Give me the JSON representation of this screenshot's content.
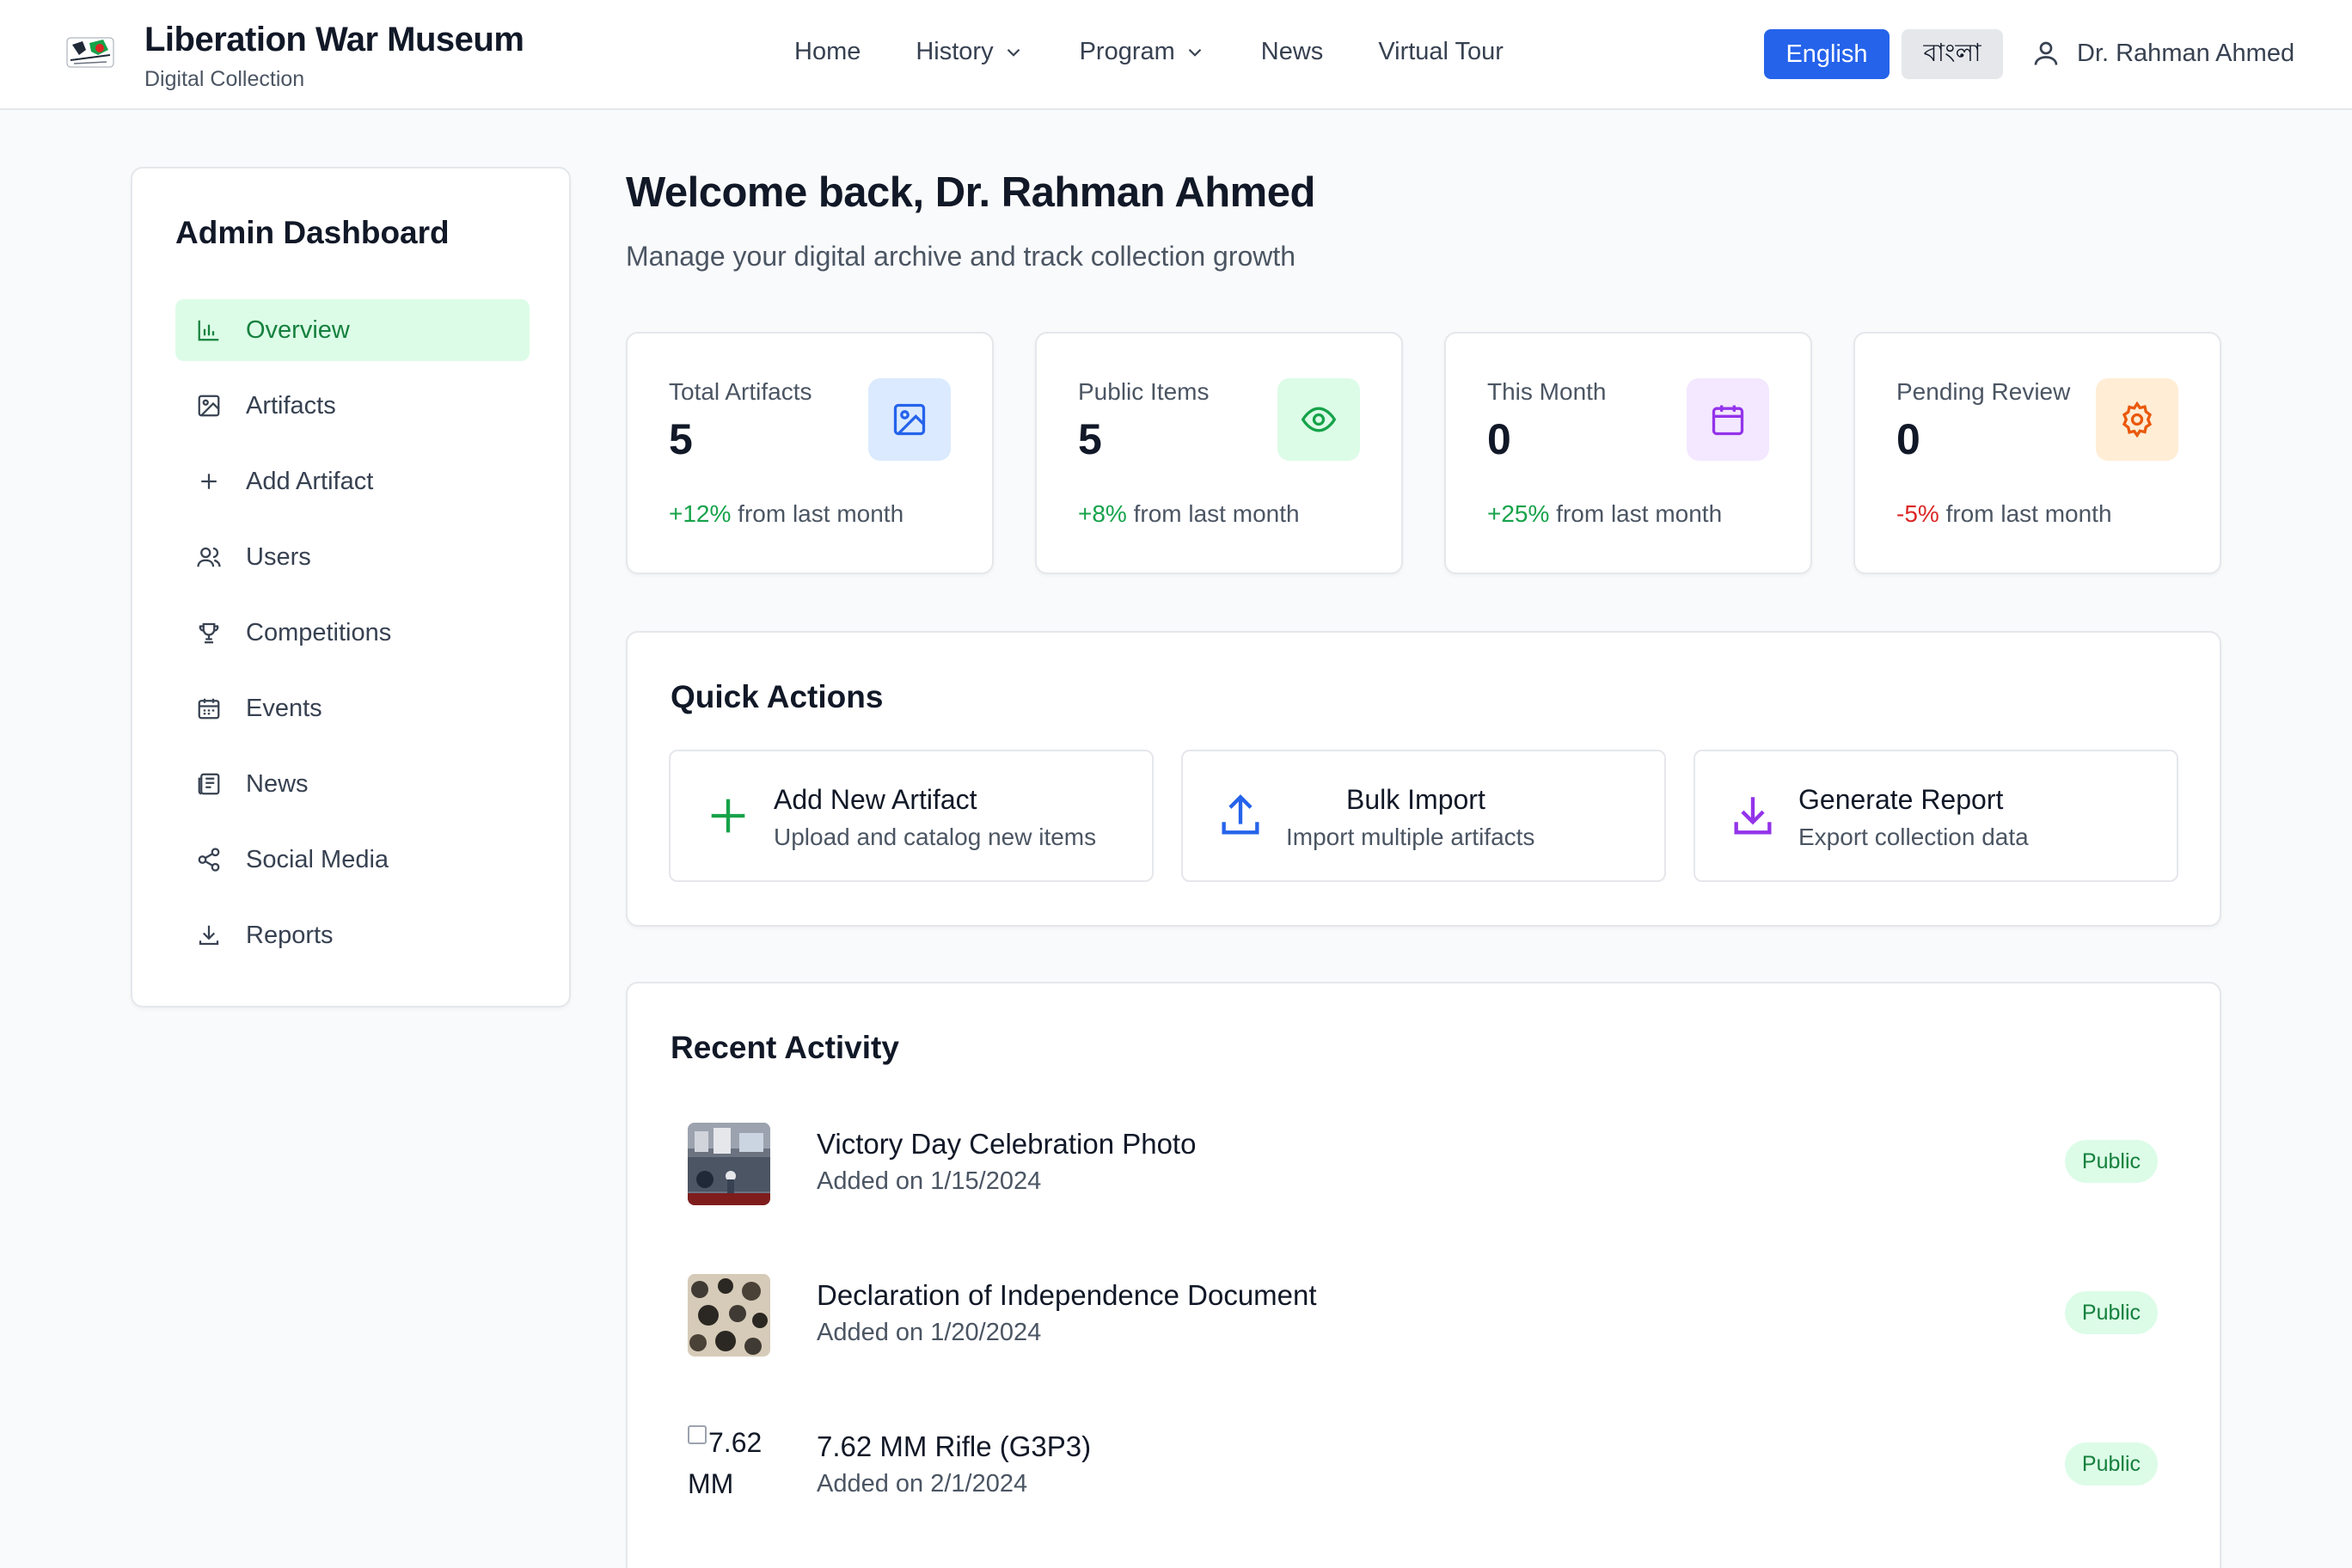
{
  "header": {
    "brand_title": "Liberation War Museum",
    "brand_subtitle": "Digital Collection",
    "nav": [
      {
        "label": "Home",
        "has_dropdown": false
      },
      {
        "label": "History",
        "has_dropdown": true
      },
      {
        "label": "Program",
        "has_dropdown": true
      },
      {
        "label": "News",
        "has_dropdown": false
      },
      {
        "label": "Virtual Tour",
        "has_dropdown": false
      }
    ],
    "lang_english": "English",
    "lang_bangla": "বাংলা",
    "user_name": "Dr. Rahman Ahmed"
  },
  "sidebar": {
    "title": "Admin Dashboard",
    "items": [
      {
        "label": "Overview",
        "icon": "bar-chart-icon",
        "active": true
      },
      {
        "label": "Artifacts",
        "icon": "image-icon",
        "active": false
      },
      {
        "label": "Add Artifact",
        "icon": "plus-icon",
        "active": false
      },
      {
        "label": "Users",
        "icon": "users-icon",
        "active": false
      },
      {
        "label": "Competitions",
        "icon": "trophy-icon",
        "active": false
      },
      {
        "label": "Events",
        "icon": "calendar-icon",
        "active": false
      },
      {
        "label": "News",
        "icon": "newspaper-icon",
        "active": false
      },
      {
        "label": "Social Media",
        "icon": "share-icon",
        "active": false
      },
      {
        "label": "Reports",
        "icon": "download-icon",
        "active": false
      }
    ]
  },
  "main": {
    "welcome": "Welcome back, Dr. Rahman Ahmed",
    "subtitle": "Manage your digital archive and track collection growth"
  },
  "stats": [
    {
      "label": "Total Artifacts",
      "value": "5",
      "change": "+12%",
      "change_suffix": " from last month",
      "trend": "up",
      "icon": "image-icon",
      "icon_bg": "#dbeafe",
      "icon_color": "#2563eb"
    },
    {
      "label": "Public Items",
      "value": "5",
      "change": "+8%",
      "change_suffix": " from last month",
      "trend": "up",
      "icon": "eye-icon",
      "icon_bg": "#dcfce7",
      "icon_color": "#16a34a"
    },
    {
      "label": "This Month",
      "value": "0",
      "change": "+25%",
      "change_suffix": " from last month",
      "trend": "up",
      "icon": "calendar-icon",
      "icon_bg": "#f3e8ff",
      "icon_color": "#9333ea"
    },
    {
      "label": "Pending Review",
      "value": "0",
      "change": "-5%",
      "change_suffix": " from last month",
      "trend": "down",
      "icon": "settings-icon",
      "icon_bg": "#ffedd5",
      "icon_color": "#ea580c"
    }
  ],
  "quick_actions": {
    "title": "Quick Actions",
    "items": [
      {
        "title": "Add New Artifact",
        "desc": "Upload and catalog new items",
        "icon": "plus-icon",
        "color": "#16a34a"
      },
      {
        "title": "Bulk Import",
        "desc": "Import multiple artifacts",
        "icon": "upload-icon",
        "color": "#2563eb"
      },
      {
        "title": "Generate Report",
        "desc": "Export collection data",
        "icon": "download-icon",
        "color": "#9333ea"
      }
    ]
  },
  "recent_activity": {
    "title": "Recent Activity",
    "items": [
      {
        "title": "Victory Day Celebration Photo",
        "date": "Added on 1/15/2024",
        "status": "Public",
        "thumb_alt": ""
      },
      {
        "title": "Declaration of Independence Document",
        "date": "Added on 1/20/2024",
        "status": "Public",
        "thumb_alt": ""
      },
      {
        "title": "7.62 MM Rifle (G3P3)",
        "date": "Added on 2/1/2024",
        "status": "Public",
        "thumb_alt_line1": "7.62",
        "thumb_alt_line2": "MM"
      }
    ]
  },
  "colors": {
    "accent": "#2563eb",
    "active_bg": "#dcfce7",
    "active_text": "#15803d",
    "positive": "#16a34a",
    "negative": "#dc2626"
  }
}
